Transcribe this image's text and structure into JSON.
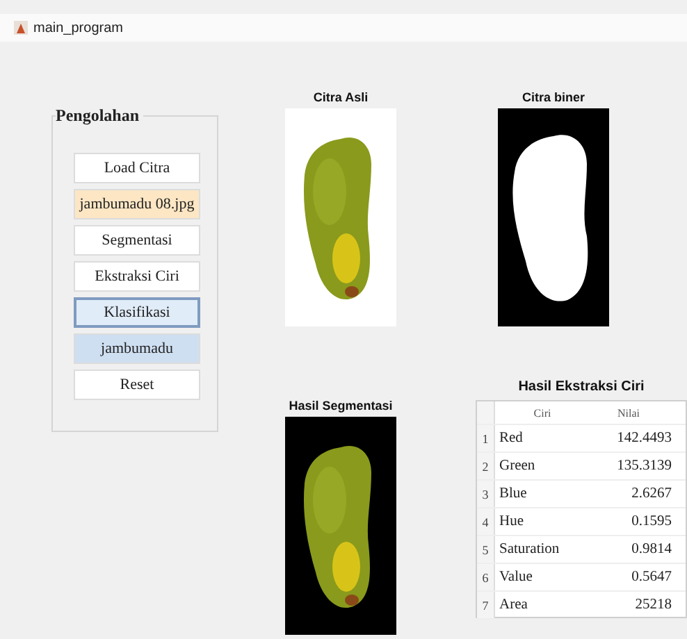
{
  "window": {
    "title": "main_program"
  },
  "panel": {
    "title": "Pengolahan",
    "buttons": [
      {
        "label": "Load Citra",
        "color": "#ffffff",
        "focused": false
      },
      {
        "label": "jambumadu 08.jpg",
        "color": "#fce6c4",
        "focused": false
      },
      {
        "label": "Segmentasi",
        "color": "#ffffff",
        "focused": false
      },
      {
        "label": "Ekstraksi Ciri",
        "color": "#ffffff",
        "focused": false
      },
      {
        "label": "Klasifikasi",
        "color": "#e0ecf8",
        "focused": true
      },
      {
        "label": "jambumadu",
        "color": "#cfdff2",
        "focused": false
      },
      {
        "label": "Reset",
        "color": "#ffffff",
        "focused": false
      }
    ]
  },
  "images": [
    {
      "title": "Citra Asli",
      "kind": "picture"
    },
    {
      "title": "Citra biner",
      "kind": "picture"
    },
    {
      "title": "Hasil Segmentasi",
      "kind": "picture"
    }
  ],
  "table": {
    "title": "Hasil Ekstraksi Ciri",
    "columns": [
      "Ciri",
      "Nilai"
    ],
    "rows": [
      {
        "index": "1",
        "name": "Red",
        "value": "142.4493"
      },
      {
        "index": "2",
        "name": "Green",
        "value": "135.3139"
      },
      {
        "index": "3",
        "name": "Blue",
        "value": "2.6267"
      },
      {
        "index": "4",
        "name": "Hue",
        "value": "0.1595"
      },
      {
        "index": "5",
        "name": "Saturation",
        "value": "0.9814"
      },
      {
        "index": "6",
        "name": "Value",
        "value": "0.5647"
      },
      {
        "index": "7",
        "name": "Area",
        "value": "25218"
      }
    ]
  }
}
